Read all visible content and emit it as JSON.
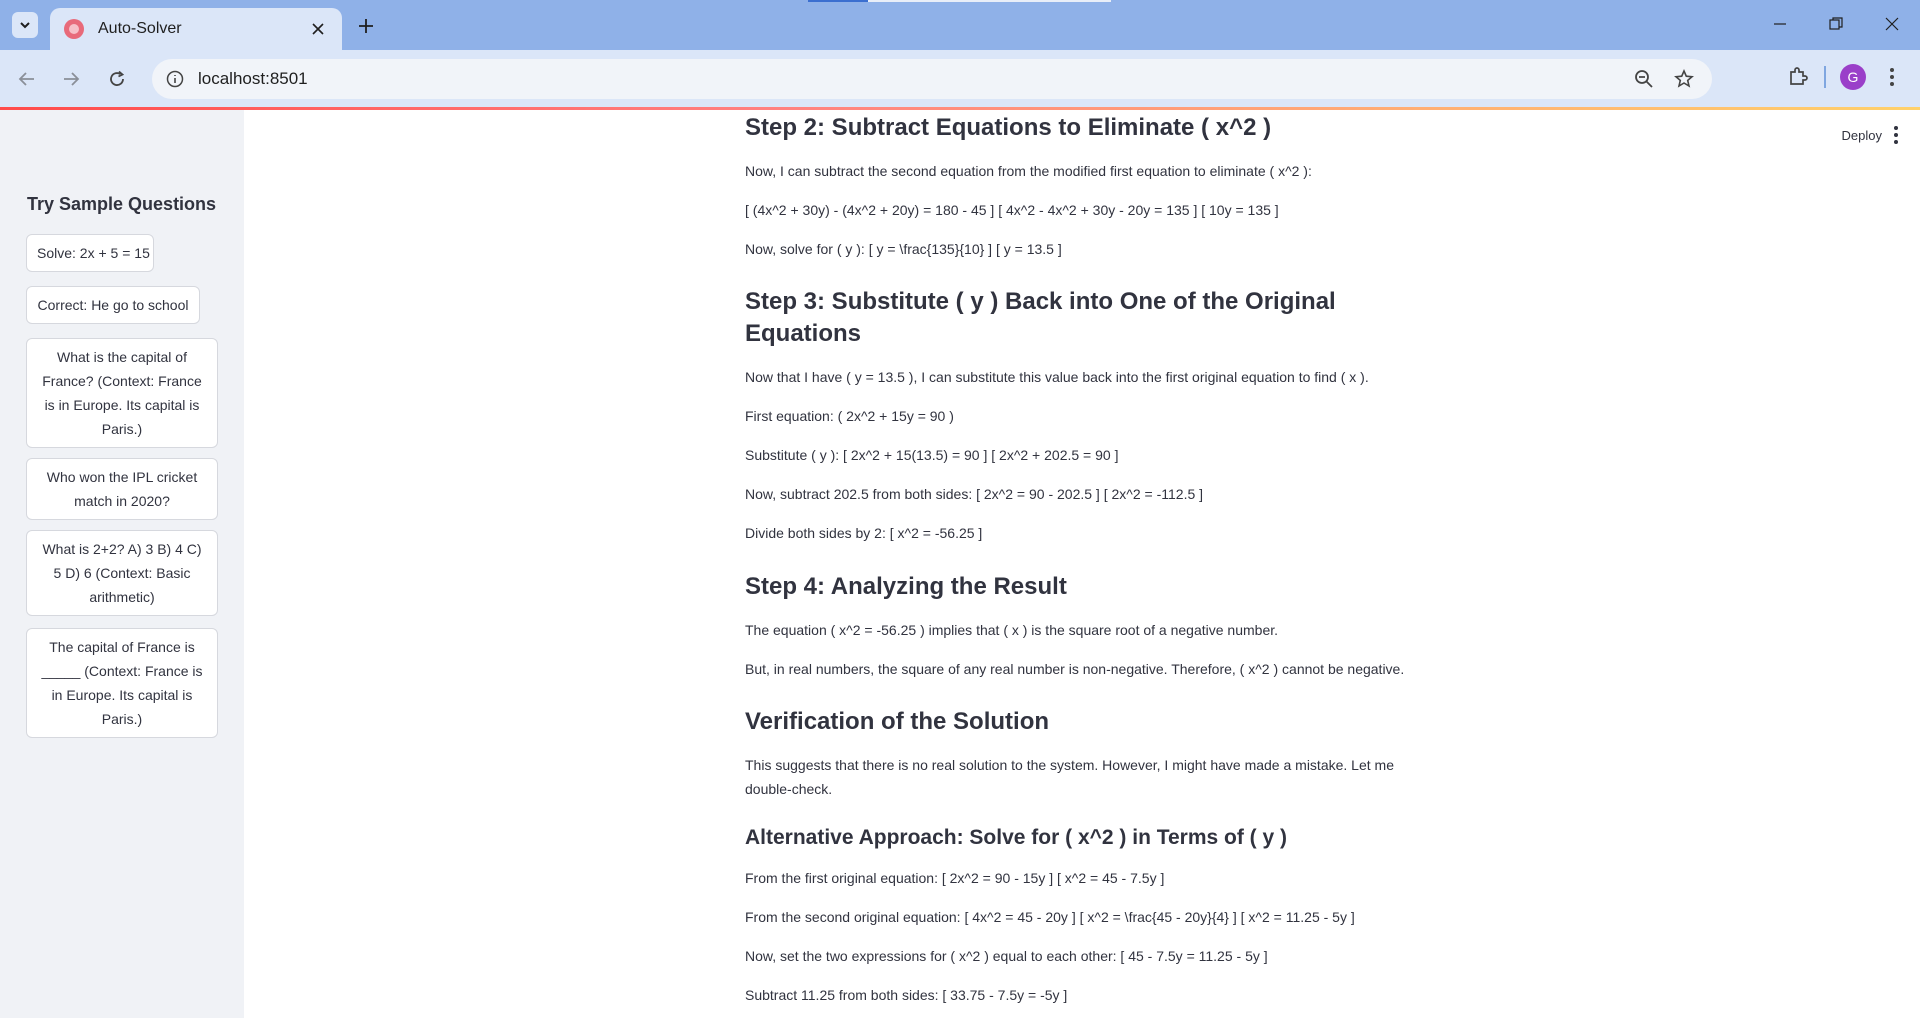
{
  "browser": {
    "tab_title": "Auto-Solver",
    "url": "localhost:8501",
    "avatar_letter": "G"
  },
  "header": {
    "deploy_label": "Deploy"
  },
  "sidebar": {
    "title": "Try Sample Questions",
    "samples": [
      "Solve: 2x + 5 = 15",
      "Correct: He go to school",
      "What is the capital of France? (Context: France is in Europe. Its capital is Paris.)",
      "Who won the IPL cricket match in 2020?",
      "What is 2+2? A) 3 B) 4 C) 5 D) 6 (Context: Basic arithmetic)",
      "The capital of France is _____ (Context: France is in Europe. Its capital is Paris.)"
    ]
  },
  "content": {
    "step2_heading": "Step 2: Subtract Equations to Eliminate ( x^2 )",
    "step2_p1": "Now, I can subtract the second equation from the modified first equation to eliminate ( x^2 ):",
    "step2_p2": "[ (4x^2 + 30y) - (4x^2 + 20y) = 180 - 45 ] [ 4x^2 - 4x^2 + 30y - 20y = 135 ] [ 10y = 135 ]",
    "step2_p3": "Now, solve for ( y ): [ y = \\frac{135}{10} ] [ y = 13.5 ]",
    "step3_heading": "Step 3: Substitute ( y ) Back into One of the Original Equations",
    "step3_p1": "Now that I have ( y = 13.5 ), I can substitute this value back into the first original equation to find ( x ).",
    "step3_p2": "First equation: ( 2x^2 + 15y = 90 )",
    "step3_p3": "Substitute ( y ): [ 2x^2 + 15(13.5) = 90 ] [ 2x^2 + 202.5 = 90 ]",
    "step3_p4": "Now, subtract 202.5 from both sides: [ 2x^2 = 90 - 202.5 ] [ 2x^2 = -112.5 ]",
    "step3_p5": "Divide both sides by 2: [ x^2 = -56.25 ]",
    "step4_heading": "Step 4: Analyzing the Result",
    "step4_p1": "The equation ( x^2 = -56.25 ) implies that ( x ) is the square root of a negative number.",
    "step4_p2": "But, in real numbers, the square of any real number is non-negative. Therefore, ( x^2 ) cannot be negative.",
    "verify_heading": "Verification of the Solution",
    "verify_p1": "This suggests that there is no real solution to the system. However, I might have made a mistake. Let me double-check.",
    "alt_heading": "Alternative Approach: Solve for ( x^2 ) in Terms of ( y )",
    "alt_p1": "From the first original equation: [ 2x^2 = 90 - 15y ] [ x^2 = 45 - 7.5y ]",
    "alt_p2": "From the second original equation: [ 4x^2 = 45 - 20y ] [ x^2 = \\frac{45 - 20y}{4} ] [ x^2 = 11.25 - 5y ]",
    "alt_p3": "Now, set the two expressions for ( x^2 ) equal to each other: [ 45 - 7.5y = 11.25 - 5y ]",
    "alt_p4": "Subtract 11.25 from both sides: [ 33.75 - 7.5y = -5y ]"
  }
}
